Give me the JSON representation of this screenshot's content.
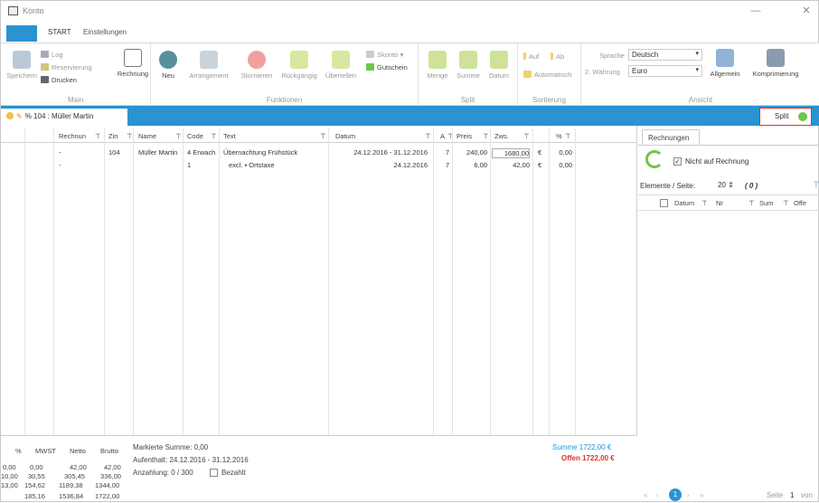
{
  "window": {
    "title": "Konto",
    "min": "—",
    "close": "✕"
  },
  "tabs": [
    {
      "label": "START"
    },
    {
      "label": "Einstellungen"
    }
  ],
  "ribbon": {
    "main": {
      "label": "Main",
      "speichern": "Speichern",
      "log": "Log",
      "reservierung": "Reservierung",
      "drucken": "Drucken",
      "rechnung": "Rechnung"
    },
    "funktionen": {
      "label": "Funktionen",
      "neu": "Neu",
      "arrangement": "Arrangement",
      "stornieren": "Stornieren",
      "rueckgaengig": "Rückgängig",
      "uebertellen": "Übertellen",
      "skonto": "Skonto",
      "gutschein": "Gutschein"
    },
    "split": {
      "label": "Split",
      "menge": "Menge",
      "summe": "Summe",
      "datum": "Datum"
    },
    "sortierung": {
      "label": "Sortierung",
      "auf": "Auf",
      "ab": "Ab",
      "automatisch": "Automatisch"
    },
    "ansicht": {
      "label": "Ansicht",
      "sprache_label": "Sprache",
      "sprache_value": "Deutsch",
      "waehrung_label": "2. Währung",
      "waehrung_value": "Euro",
      "allgemein": "Allgemein",
      "komprimierung": "Komprimierung"
    }
  },
  "doc_tab": {
    "label": "% 104 : Müller Martin"
  },
  "split_button": {
    "label": "Split"
  },
  "grid": {
    "headers": [
      "Rechnun",
      "Zin",
      "Name",
      "Code",
      "Text",
      "Datum",
      "A",
      "Preis",
      "Zws.",
      "%"
    ],
    "rows": [
      {
        "rechnung": "-",
        "zimmer": "104",
        "name": "Müller Martin",
        "code": "4 Erwach",
        "text": "Übernachtung Frühstück",
        "datum": "24.12.2016 - 31.12.2016",
        "anzahl": "7",
        "preis": "240,00",
        "zws": "1680,00",
        "cur": "€",
        "pct": "0,00"
      },
      {
        "rechnung": "-",
        "zimmer": "",
        "name": "",
        "code": "1",
        "text": "excl.  ▪  Ortstaxe",
        "datum": "24.12.2016",
        "anzahl": "7",
        "preis": "6,00",
        "zws": "42,00",
        "cur": "€",
        "pct": "0,00"
      }
    ]
  },
  "bottom": {
    "table_headers": [
      "%",
      "MWST",
      "Netto",
      "Brutto"
    ],
    "table_rows": [
      [
        "0,00",
        "0,00",
        "42,00",
        "42,00"
      ],
      [
        "10,00",
        "30,55",
        "305,45",
        "336,00"
      ],
      [
        "13,00",
        "154,62",
        "1189,38",
        "1344,00"
      ],
      [
        "",
        "185,16",
        "1536,84",
        "1722,00"
      ]
    ],
    "markierte": "Markierte Summe: 0,00",
    "aufenthalt": "Aufenthalt: 24.12.2016 - 31.12.2016",
    "anzahlung": "Anzahlung: 0 / 300",
    "bezahlt": "Bezahlt",
    "summe": "Summe  1722,00  €",
    "offen": "Offen  1722,00  €"
  },
  "right_panel": {
    "tab": "Rechnungen",
    "nicht_auf_rechnung": "Nicht auf Rechnung",
    "elemente_label": "Elemente / Seite:",
    "elemente_value": "20",
    "count": "( 0 )",
    "headers": [
      "Datum",
      "Nr",
      "Sum",
      "Offe"
    ],
    "page_label": "Seite",
    "page_value": "1",
    "page_of": "von"
  },
  "colors": {
    "accent": "#2b93d1",
    "summe": "#2b93d1",
    "offen": "#d9342b",
    "green": "#6cc84a"
  }
}
